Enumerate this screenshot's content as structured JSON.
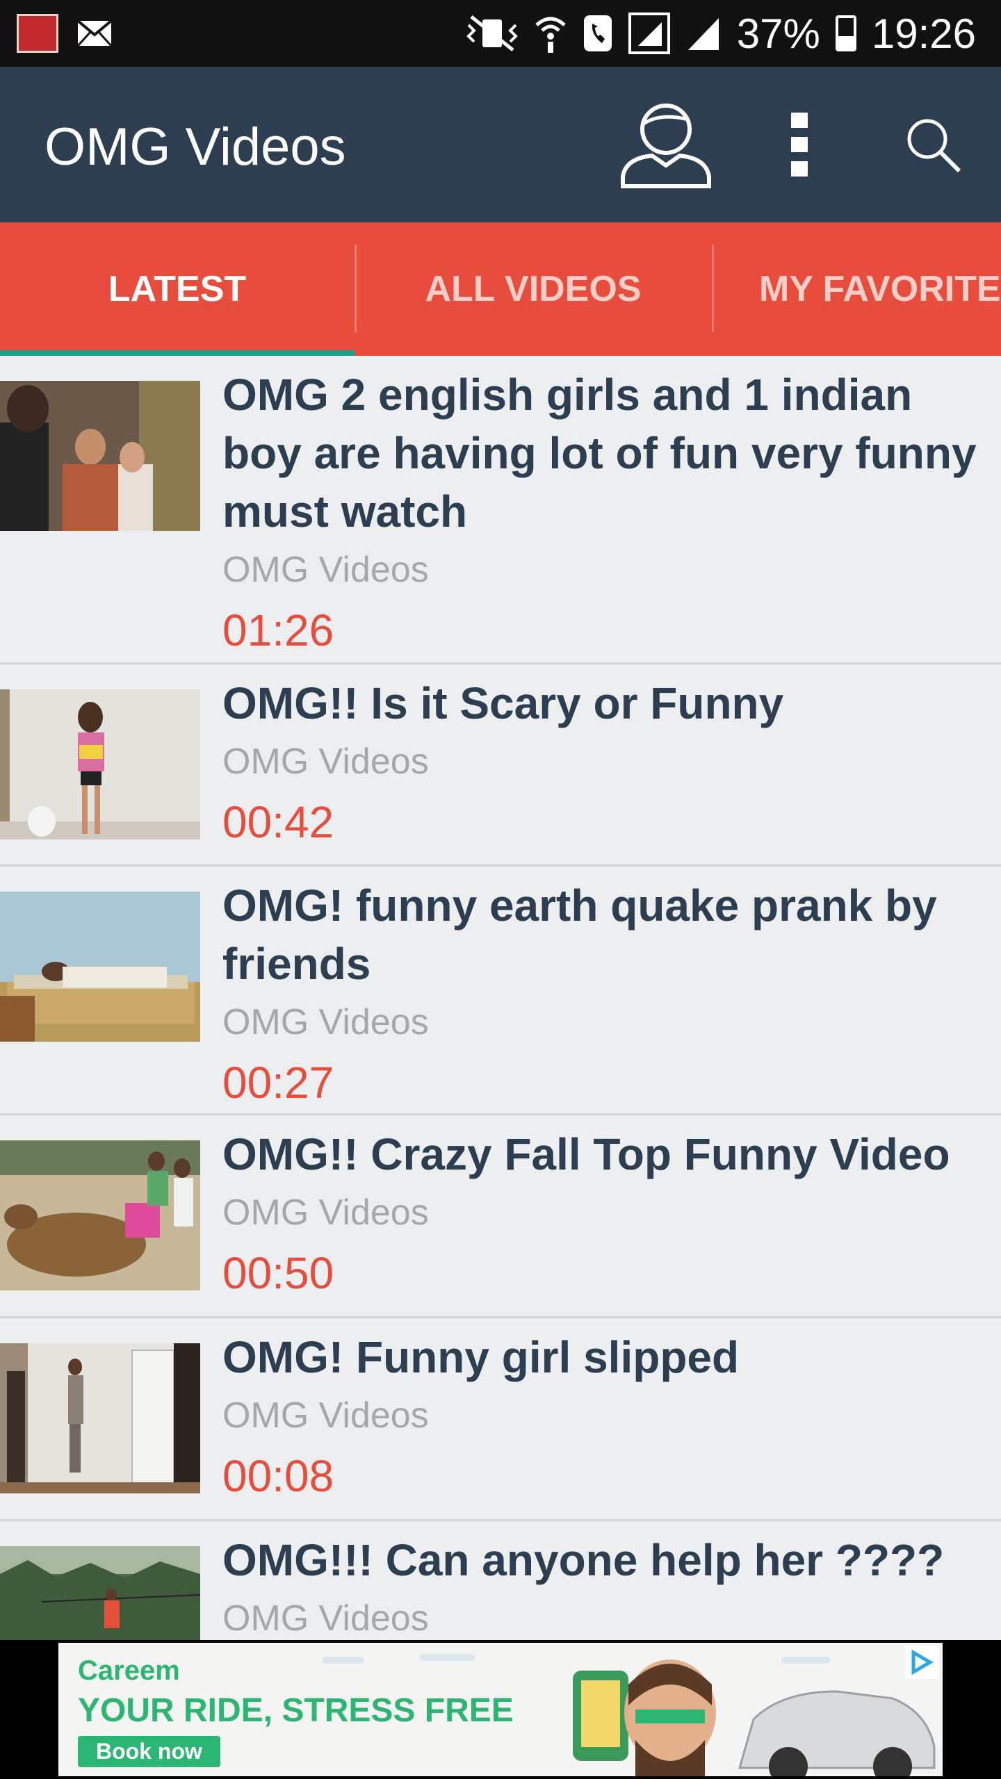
{
  "status_bar": {
    "battery": "37%",
    "time": "19:26"
  },
  "app_bar": {
    "title": "OMG Videos"
  },
  "tabs": [
    {
      "label": "LATEST"
    },
    {
      "label": "ALL VIDEOS"
    },
    {
      "label": "MY FAVORITE"
    }
  ],
  "videos": [
    {
      "title": "OMG 2 english girls and 1 indian boy are having lot of fun very funny must watch",
      "channel": "OMG Videos",
      "duration": "01:26"
    },
    {
      "title": "OMG!! Is it Scary or Funny",
      "channel": "OMG Videos",
      "duration": "00:42"
    },
    {
      "title": "OMG! funny earth quake prank by friends",
      "channel": "OMG Videos",
      "duration": "00:27"
    },
    {
      "title": "OMG!! Crazy Fall Top Funny Video",
      "channel": "OMG Videos",
      "duration": "00:50"
    },
    {
      "title": "OMG! Funny girl slipped",
      "channel": "OMG Videos",
      "duration": "00:08"
    },
    {
      "title": "OMG!!! Can anyone help her ????",
      "channel": "OMG Videos",
      "duration": ""
    }
  ],
  "ad": {
    "brand": "Careem",
    "headline": "YOUR RIDE, STRESS FREE",
    "cta": "Book now"
  },
  "colors": {
    "app_bar": "#2c3e50",
    "tab_bar": "#e74c3c",
    "tab_indicator": "#16a085",
    "duration_text": "#e74c3c",
    "title_text": "#2c3e50"
  }
}
